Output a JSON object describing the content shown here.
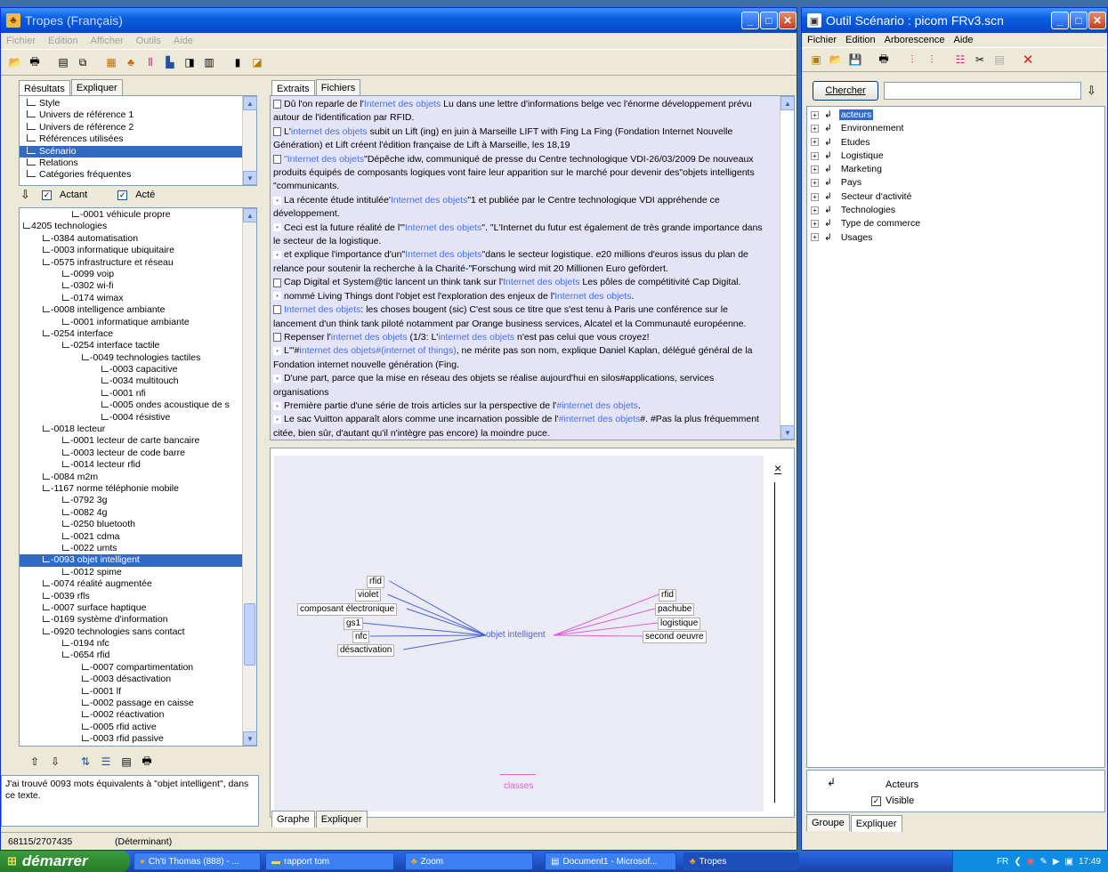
{
  "tropes_window": {
    "title": "Tropes (Français)",
    "menu": [
      "Fichier",
      "Edition",
      "Afficher",
      "Outils",
      "Aide"
    ],
    "results_tabs": [
      "Résultats",
      "Expliquer"
    ],
    "categories": [
      {
        "label": "Style",
        "selected": false
      },
      {
        "label": "Univers de référence 1",
        "selected": false
      },
      {
        "label": "Univers de référence 2",
        "selected": false
      },
      {
        "label": "Références utilisées",
        "selected": false
      },
      {
        "label": "Scénario",
        "selected": true
      },
      {
        "label": "Relations",
        "selected": false
      },
      {
        "label": "Catégories fréquentes",
        "selected": false
      }
    ],
    "filter": {
      "actant_label": "Actant",
      "acte_label": "Acté",
      "actant_checked": true,
      "acte_checked": true
    },
    "tree": [
      {
        "indent": 5,
        "text": "-0001 véhicule propre",
        "selected": false
      },
      {
        "indent": 0,
        "text": "4205 technologies",
        "selected": false
      },
      {
        "indent": 2,
        "text": "-0384 automatisation",
        "selected": false
      },
      {
        "indent": 2,
        "text": "-0003 informatique ubiquitaire",
        "selected": false
      },
      {
        "indent": 2,
        "text": "-0575 infrastructure et réseau",
        "selected": false
      },
      {
        "indent": 4,
        "text": "-0099 voip",
        "selected": false
      },
      {
        "indent": 4,
        "text": "-0302 wi-fi",
        "selected": false
      },
      {
        "indent": 4,
        "text": "-0174 wimax",
        "selected": false
      },
      {
        "indent": 2,
        "text": "-0008 intelligence ambiante",
        "selected": false
      },
      {
        "indent": 4,
        "text": "-0001 informatique ambiante",
        "selected": false
      },
      {
        "indent": 2,
        "text": "-0254 interface",
        "selected": false
      },
      {
        "indent": 4,
        "text": "-0254 interface tactile",
        "selected": false
      },
      {
        "indent": 6,
        "text": "-0049 technologies tactiles",
        "selected": false
      },
      {
        "indent": 8,
        "text": "-0003 capacitive",
        "selected": false
      },
      {
        "indent": 8,
        "text": "-0034 multitouch",
        "selected": false
      },
      {
        "indent": 8,
        "text": "-0001 nfi",
        "selected": false
      },
      {
        "indent": 8,
        "text": "-0005 ondes acoustique de s",
        "selected": false
      },
      {
        "indent": 8,
        "text": "-0004 résistive",
        "selected": false
      },
      {
        "indent": 2,
        "text": "-0018 lecteur",
        "selected": false
      },
      {
        "indent": 4,
        "text": "-0001 lecteur de carte bancaire",
        "selected": false
      },
      {
        "indent": 4,
        "text": "-0003 lecteur de code barre",
        "selected": false
      },
      {
        "indent": 4,
        "text": "-0014 lecteur rfid",
        "selected": false
      },
      {
        "indent": 2,
        "text": "-0084 m2m",
        "selected": false
      },
      {
        "indent": 2,
        "text": "-1167 norme téléphonie mobile",
        "selected": false
      },
      {
        "indent": 4,
        "text": "-0792 3g",
        "selected": false
      },
      {
        "indent": 4,
        "text": "-0082 4g",
        "selected": false
      },
      {
        "indent": 4,
        "text": "-0250 bluetooth",
        "selected": false
      },
      {
        "indent": 4,
        "text": "-0021 cdma",
        "selected": false
      },
      {
        "indent": 4,
        "text": "-0022 umts",
        "selected": false
      },
      {
        "indent": 2,
        "text": "-0093 objet intelligent",
        "selected": true
      },
      {
        "indent": 4,
        "text": "-0012 spime",
        "selected": false
      },
      {
        "indent": 2,
        "text": "-0074 réalité augmentée",
        "selected": false
      },
      {
        "indent": 2,
        "text": "-0039 rfls",
        "selected": false
      },
      {
        "indent": 2,
        "text": "-0007 surface haptique",
        "selected": false
      },
      {
        "indent": 2,
        "text": "-0169 système d'information",
        "selected": false
      },
      {
        "indent": 2,
        "text": "-0920 technologies sans contact",
        "selected": false
      },
      {
        "indent": 4,
        "text": "-0194 nfc",
        "selected": false
      },
      {
        "indent": 4,
        "text": "-0654 rfid",
        "selected": false
      },
      {
        "indent": 6,
        "text": "-0007 compartimentation",
        "selected": false
      },
      {
        "indent": 6,
        "text": "-0003 désactivation",
        "selected": false
      },
      {
        "indent": 6,
        "text": "-0001 lf",
        "selected": false
      },
      {
        "indent": 6,
        "text": "-0002 passage en caisse",
        "selected": false
      },
      {
        "indent": 6,
        "text": "-0002 réactivation",
        "selected": false
      },
      {
        "indent": 6,
        "text": "-0005 rfid active",
        "selected": false
      },
      {
        "indent": 6,
        "text": "-0003 rfid passive",
        "selected": false
      }
    ],
    "info_text": "J'ai trouvé 0093 mots équivalents à \"objet intelligent\", dans ce texte.",
    "status_left": "68115/2707435",
    "status_right": "(Déterminant)",
    "extract_tabs": [
      "Extraits",
      "Fichiers"
    ],
    "graph_tabs": [
      "Graphe",
      "Expliquer"
    ]
  },
  "extracts": [
    {
      "icon": "doc",
      "parts": [
        [
          "n",
          "Dû l'on reparle de l'"
        ],
        [
          "b",
          "Internet des objets"
        ],
        [
          "n",
          " Lu dans une lettre d'informations belge vec l'énorme développement prévu"
        ]
      ]
    },
    {
      "icon": "",
      "parts": [
        [
          "n",
          "autour de l'identification par RFID."
        ]
      ]
    },
    {
      "icon": "doc",
      "parts": [
        [
          "n",
          "L'"
        ],
        [
          "b",
          "internet des objets"
        ],
        [
          "n",
          " subit un Lift (ing) en juin à Marseille LIFT with Fing La Fing (Fondation Internet Nouvelle"
        ]
      ]
    },
    {
      "icon": "",
      "parts": [
        [
          "n",
          "Génération) et Lift créent l'édition française de Lift à Marseille, les 18,19"
        ]
      ]
    },
    {
      "icon": "doc",
      "parts": [
        [
          "b",
          "\"Internet des objets"
        ],
        [
          "n",
          "\"Dépêche idw, communiqué de presse du Centre technologique VDI-26/03/2009 De nouveaux"
        ]
      ]
    },
    {
      "icon": "",
      "parts": [
        [
          "n",
          "produits équipés de composants logiques vont faire leur apparition sur le marché pour devenir des\"objets intelligents"
        ]
      ]
    },
    {
      "icon": "",
      "parts": [
        [
          "n",
          "\"communicants."
        ]
      ]
    },
    {
      "icon": "dot",
      "parts": [
        [
          "n",
          "La récente étude intitulée'"
        ],
        [
          "b",
          "Internet des objets"
        ],
        [
          "n",
          "\"1   et publiée par le Centre technologique VDI appréhende ce"
        ]
      ]
    },
    {
      "icon": "",
      "parts": [
        [
          "n",
          "développement."
        ]
      ]
    },
    {
      "icon": "dot",
      "parts": [
        [
          "n",
          "Ceci est la future réalité de l'\""
        ],
        [
          "b",
          "Internet des objets"
        ],
        [
          "n",
          "\". \"L'Internet du futur est également de très grande importance dans"
        ]
      ]
    },
    {
      "icon": "",
      "parts": [
        [
          "n",
          "le secteur de la logistique."
        ]
      ]
    },
    {
      "icon": "dot",
      "parts": [
        [
          "n",
          "et explique l'importance d'un\""
        ],
        [
          "b",
          "Internet des objets"
        ],
        [
          "n",
          "\"dans le secteur logistique. e20 millions d'euros issus du plan de"
        ]
      ]
    },
    {
      "icon": "",
      "parts": [
        [
          "n",
          "relance pour soutenir la recherche à la Charité-\"Forschung wird mit 20 Millionen Euro gefördert."
        ]
      ]
    },
    {
      "icon": "doc",
      "parts": [
        [
          "n",
          "Cap Digital et System@tic lancent un think tank sur l'"
        ],
        [
          "b",
          "Internet des objets"
        ],
        [
          "n",
          " Les pôles de compétitivité Cap Digital."
        ]
      ]
    },
    {
      "icon": "dot",
      "parts": [
        [
          "n",
          "nommé Living Things dont l'objet est l'exploration des enjeux de l'"
        ],
        [
          "b",
          "Internet des objets"
        ],
        [
          "n",
          "."
        ]
      ]
    },
    {
      "icon": "doc",
      "parts": [
        [
          "b",
          "Internet des objets"
        ],
        [
          "n",
          ": les choses bougent (sic) C'est sous ce titre  que s'est tenu à Paris une conférence sur le"
        ]
      ]
    },
    {
      "icon": "",
      "parts": [
        [
          "n",
          "lancement d'un think tank piloté notamment par Orange business services, Alcatel et la Communauté européenne."
        ]
      ]
    },
    {
      "icon": "doc",
      "parts": [
        [
          "n",
          "Repenser l'"
        ],
        [
          "b",
          "internet des objets"
        ],
        [
          "n",
          " (1/3: L'"
        ],
        [
          "b",
          "internet des objets"
        ],
        [
          "n",
          " n'est pas celui  que vous croyez!"
        ]
      ]
    },
    {
      "icon": "dot",
      "parts": [
        [
          "n",
          "L'\"#"
        ],
        [
          "b",
          "internet des objets#(internet of things)"
        ],
        [
          "n",
          ", ne mérite pas son nom, explique Daniel Kaplan, délégué général de la"
        ]
      ]
    },
    {
      "icon": "",
      "parts": [
        [
          "n",
          "Fondation internet nouvelle génération (Fing."
        ]
      ]
    },
    {
      "icon": "dot",
      "parts": [
        [
          "n",
          "D'une part, parce que la mise en réseau des objets se réalise aujourd'hui en silos#applications, services"
        ]
      ]
    },
    {
      "icon": "",
      "parts": [
        [
          "n",
          "organisations"
        ]
      ]
    },
    {
      "icon": "dot",
      "parts": [
        [
          "n",
          "Première partie d'une série de trois articles sur la perspective de l'"
        ],
        [
          "b",
          "#internet des objets"
        ],
        [
          "n",
          "."
        ]
      ]
    },
    {
      "icon": "dot",
      "parts": [
        [
          "n",
          "Le sac Vuitton apparaît alors comme une incarnation possible de l'"
        ],
        [
          "b",
          "#internet des objets"
        ],
        [
          "n",
          "#. #Pas la plus fréquemment"
        ]
      ]
    },
    {
      "icon": "",
      "parts": [
        [
          "n",
          "citée, bien sûr, d'autant qu'il n'intègre pas encore) la moindre puce."
        ]
      ]
    }
  ],
  "graph": {
    "center": "objet intelligent",
    "left": [
      "rfid",
      "violet",
      "composant électronique",
      "gs1",
      "nfc",
      "désactivation"
    ],
    "right": [
      "rfid",
      "pachube",
      "logistique",
      "second oeuvre"
    ],
    "legend": "classes",
    "close": "×",
    "colors": {
      "left": "#4a63d4",
      "right": "#e060d8"
    }
  },
  "scenario_window": {
    "title": "Outil Scénario : picom FRv3.scn",
    "menu": [
      "Fichier",
      "Edition",
      "Arborescence",
      "Aide"
    ],
    "search_button": "Chercher",
    "search_value": "",
    "tree": [
      {
        "label": "acteurs",
        "selected": true
      },
      {
        "label": "Environnement",
        "selected": false
      },
      {
        "label": "Etudes",
        "selected": false
      },
      {
        "label": "Logistique",
        "selected": false
      },
      {
        "label": "Marketing",
        "selected": false
      },
      {
        "label": "Pays",
        "selected": false
      },
      {
        "label": "Secteur d'activité",
        "selected": false
      },
      {
        "label": "Technologies",
        "selected": false
      },
      {
        "label": "Type de commerce",
        "selected": false
      },
      {
        "label": "Usages",
        "selected": false
      }
    ],
    "bottom_title": "Acteurs",
    "visible_label": "Visible",
    "visible_checked": true,
    "tabs": [
      "Groupe",
      "Expliquer"
    ]
  },
  "taskbar": {
    "start": "démarrer",
    "tasks": [
      "Ch'ti Thomas (888) - ...",
      "rapport tom",
      "Zoom",
      "Document1 - Microsof...",
      "Tropes"
    ],
    "lang": "FR",
    "time": "17:49"
  }
}
